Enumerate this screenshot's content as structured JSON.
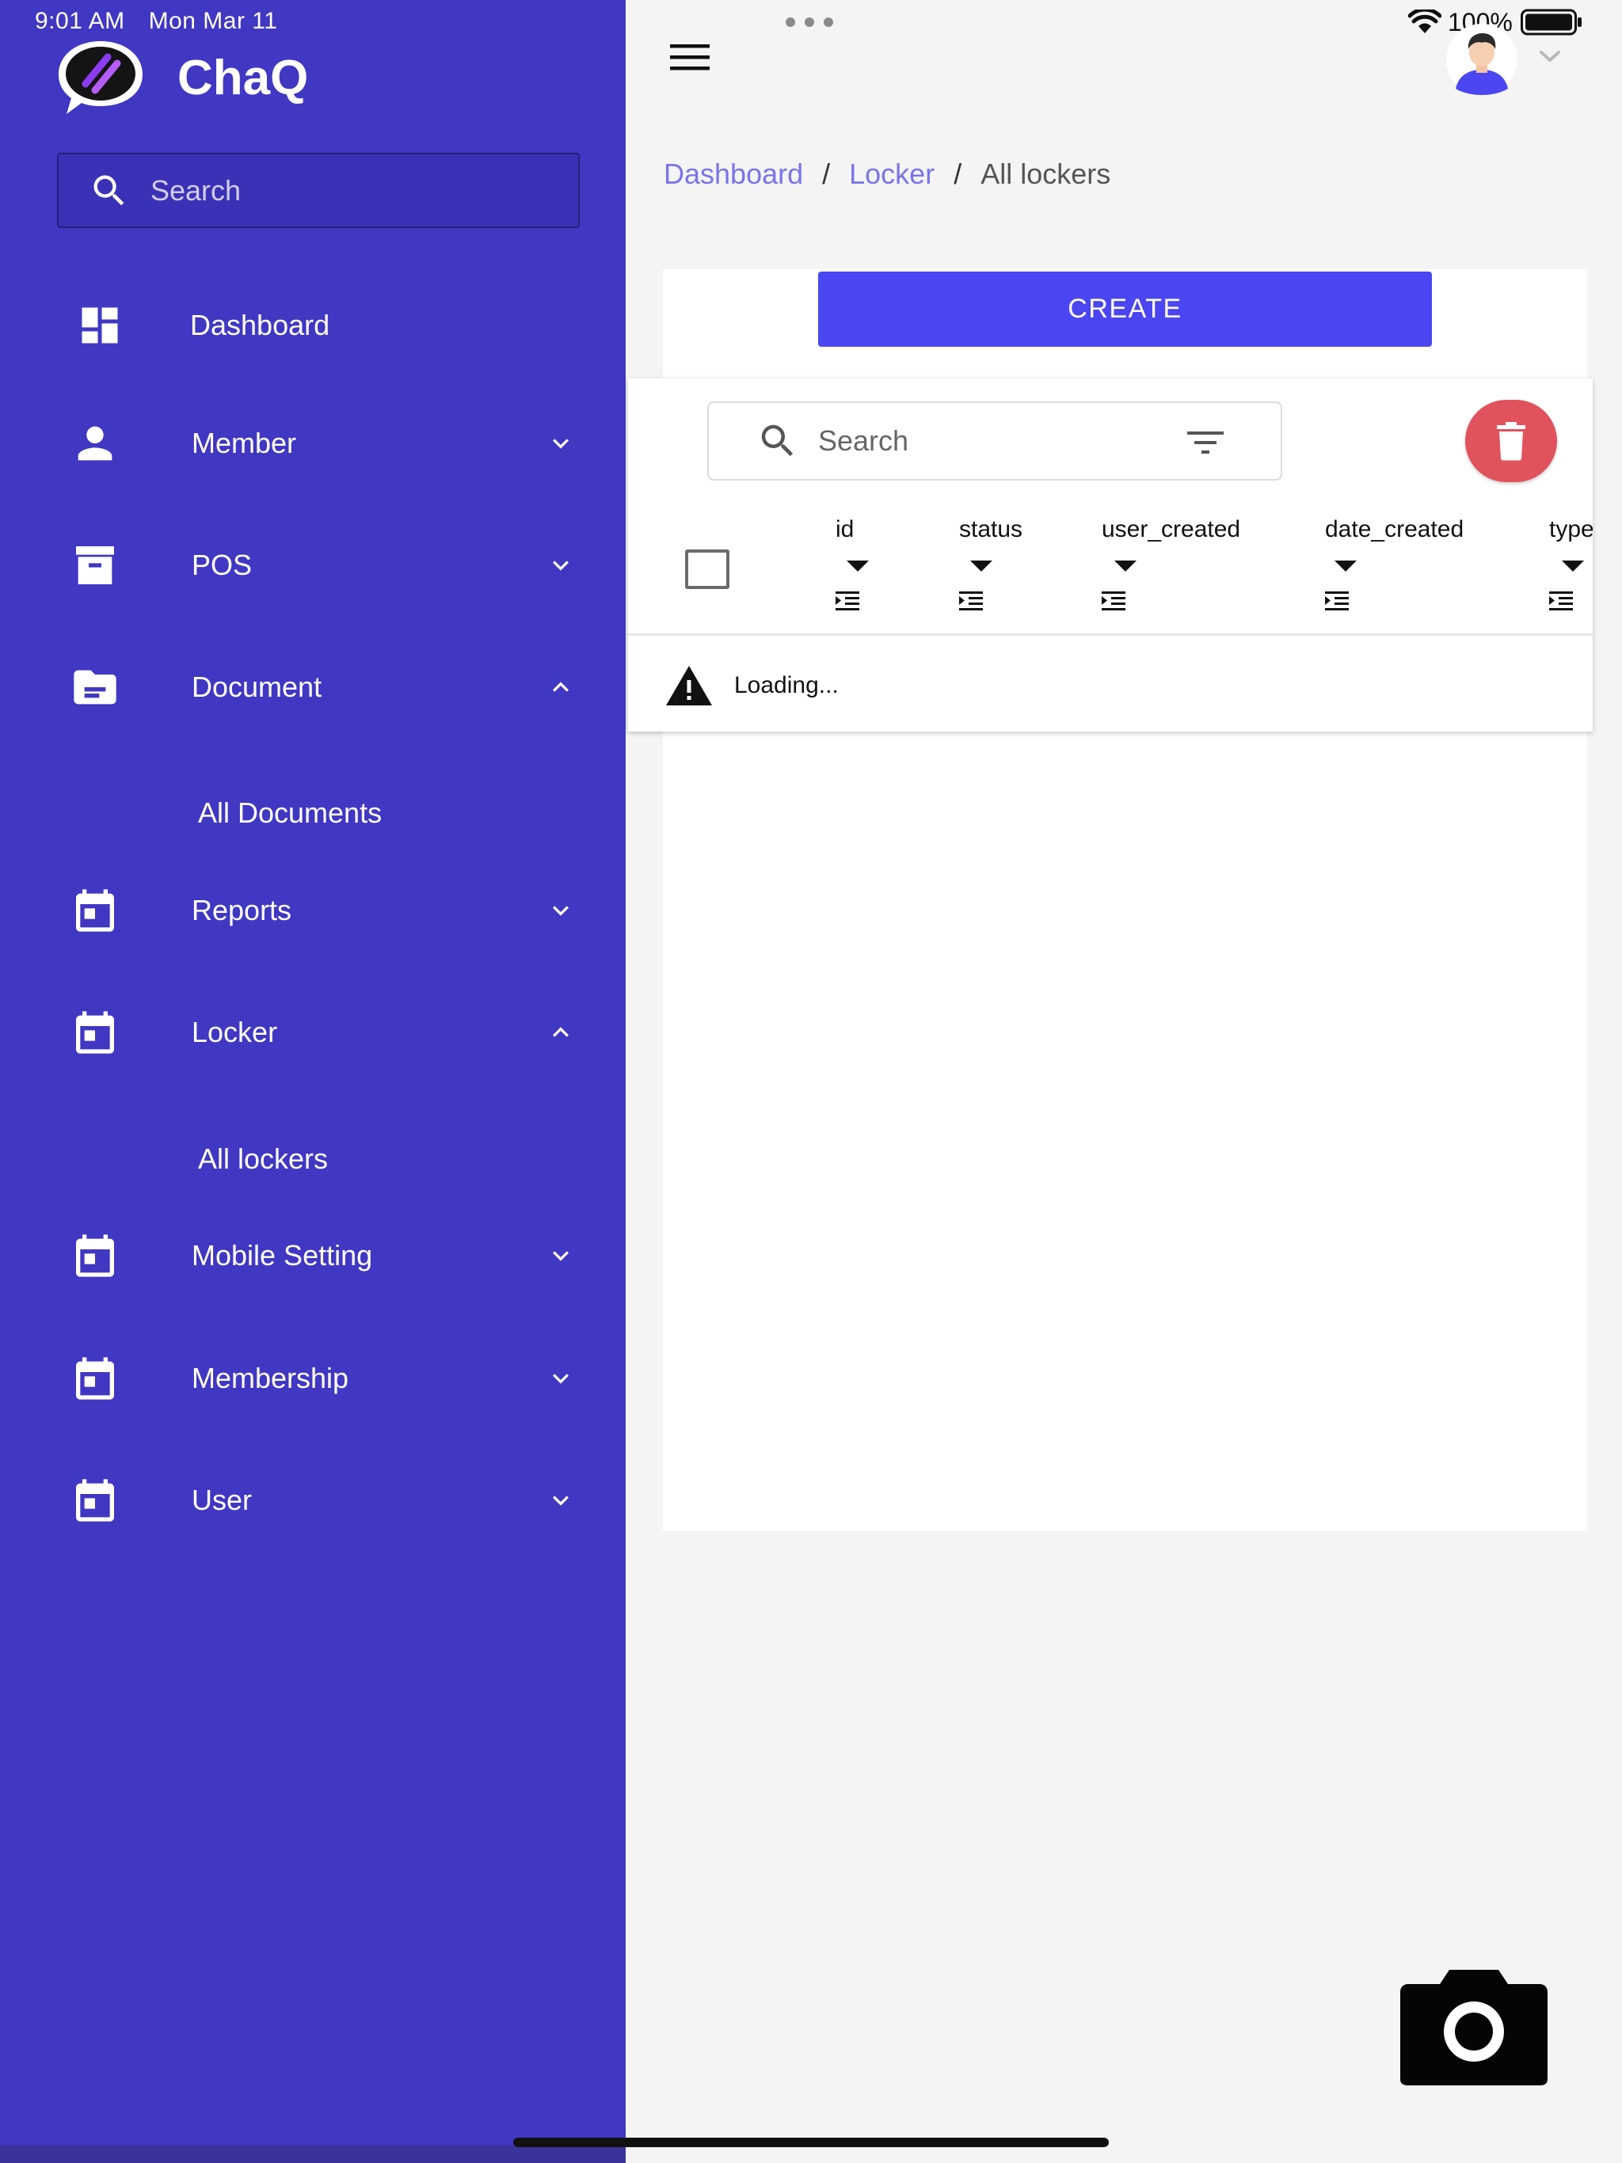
{
  "status_bar": {
    "time": "9:01 AM",
    "date": "Mon Mar 11",
    "battery": "100%"
  },
  "brand": {
    "name": "ChaQ",
    "logo_icon": "chat-bubble-logo-icon"
  },
  "sidebar": {
    "search_placeholder": "Search",
    "items": [
      {
        "label": "Dashboard",
        "icon": "dashboard-icon",
        "expanded": null
      },
      {
        "label": "Member",
        "icon": "person-icon",
        "expanded": false
      },
      {
        "label": "POS",
        "icon": "archive-box-icon",
        "expanded": false
      },
      {
        "label": "Document",
        "icon": "folder-icon",
        "expanded": true,
        "children": [
          "All Documents"
        ]
      },
      {
        "label": "Reports",
        "icon": "calendar-icon",
        "expanded": false
      },
      {
        "label": "Locker",
        "icon": "calendar-icon",
        "expanded": true,
        "children": [
          "All lockers"
        ]
      },
      {
        "label": "Mobile Setting",
        "icon": "calendar-icon",
        "expanded": false
      },
      {
        "label": "Membership",
        "icon": "calendar-icon",
        "expanded": false
      },
      {
        "label": "User",
        "icon": "calendar-icon",
        "expanded": false
      }
    ]
  },
  "breadcrumb": {
    "items": [
      "Dashboard",
      "Locker",
      "All lockers"
    ],
    "separator": "/"
  },
  "main": {
    "create_label": "CREATE",
    "table": {
      "search_placeholder": "Search",
      "columns": [
        "id",
        "status",
        "user_created",
        "date_created",
        "type"
      ],
      "status_text": "Loading..."
    }
  },
  "colors": {
    "sidebar_bg": "#4037c3",
    "accent": "#4b46f1",
    "link": "#7b73ea",
    "delete": "#e0525c"
  }
}
